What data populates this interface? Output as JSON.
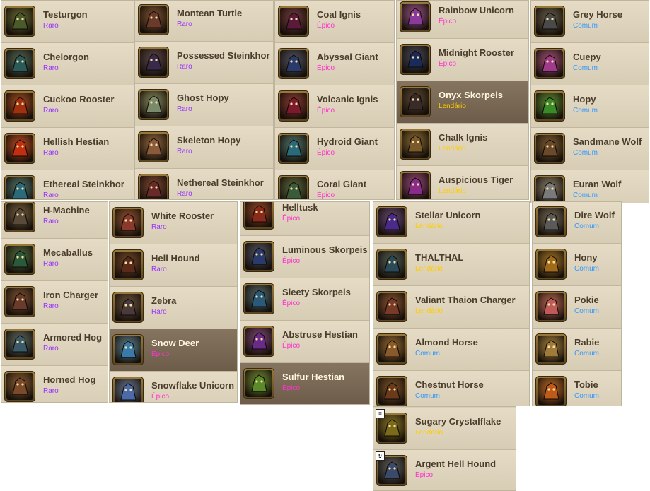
{
  "rarity_colors": {
    "Raro": "#9933ff",
    "Épico": "#ff33cc",
    "Lendário": "#ffcc00",
    "Comum": "#3399ff"
  },
  "panels": [
    {
      "items": [
        {
          "name": "Testurgon",
          "rarity": "Raro",
          "icon": "monster-portrait-icon",
          "color": "#4a5a2a"
        },
        {
          "name": "Chelorgon",
          "rarity": "Raro",
          "icon": "monster-portrait-icon",
          "color": "#2a5a5a"
        },
        {
          "name": "Cuckoo Rooster",
          "rarity": "Raro",
          "icon": "rooster-portrait-icon",
          "color": "#a03010"
        },
        {
          "name": "Hellish Hestian",
          "rarity": "Raro",
          "icon": "hestian-portrait-icon",
          "color": "#c03010"
        },
        {
          "name": "Ethereal Steinkhor",
          "rarity": "Raro",
          "icon": "steinkhor-portrait-icon",
          "color": "#2a6a7a"
        }
      ]
    },
    {
      "items": [
        {
          "name": "Montean Turtle",
          "rarity": "Raro",
          "icon": "turtle-portrait-icon",
          "color": "#6a3a2a"
        },
        {
          "name": "Possessed Steinkhor",
          "rarity": "Raro",
          "icon": "steinkhor-portrait-icon",
          "color": "#3a2a4a"
        },
        {
          "name": "Ghost Hopy",
          "rarity": "Raro",
          "icon": "hopy-portrait-icon",
          "color": "#7a8a6a"
        },
        {
          "name": "Skeleton Hopy",
          "rarity": "Raro",
          "icon": "hopy-portrait-icon",
          "color": "#8a5a3a"
        },
        {
          "name": "Nethereal Steinkhor",
          "rarity": "Raro",
          "icon": "steinkhor-portrait-icon",
          "color": "#6a2a2a"
        }
      ]
    },
    {
      "items": [
        {
          "name": "Coal Ignis",
          "rarity": "Épico",
          "icon": "ignis-portrait-icon",
          "color": "#5a1a3a"
        },
        {
          "name": "Abyssal Giant",
          "rarity": "Épico",
          "icon": "giant-portrait-icon",
          "color": "#2a3a6a"
        },
        {
          "name": "Volcanic Ignis",
          "rarity": "Épico",
          "icon": "ignis-portrait-icon",
          "color": "#7a1a2a"
        },
        {
          "name": "Hydroid Giant",
          "rarity": "Épico",
          "icon": "giant-portrait-icon",
          "color": "#2a6a7a"
        },
        {
          "name": "Coral Giant",
          "rarity": "Épico",
          "icon": "giant-portrait-icon",
          "color": "#3a5a3a"
        }
      ]
    },
    {
      "items": [
        {
          "name": "Rainbow Unicorn",
          "rarity": "Épico",
          "icon": "unicorn-portrait-icon",
          "color": "#8a3a9a"
        },
        {
          "name": "Midnight Rooster",
          "rarity": "Épico",
          "icon": "rooster-portrait-icon",
          "color": "#1a2a5a"
        },
        {
          "name": "Onyx Skorpeis",
          "rarity": "Lendário",
          "icon": "skorpeis-portrait-icon",
          "color": "#3a2a2a",
          "selected": true
        },
        {
          "name": "Chalk Ignis",
          "rarity": "Lendário",
          "icon": "ignis-portrait-icon",
          "color": "#7a5a2a"
        },
        {
          "name": "Auspicious Tiger",
          "rarity": "Lendário",
          "icon": "tiger-portrait-icon",
          "color": "#8a2a8a"
        }
      ]
    },
    {
      "items": [
        {
          "name": "Grey Horse",
          "rarity": "Comum",
          "icon": "horse-portrait-icon",
          "color": "#4a4a4a"
        },
        {
          "name": "Cuepy",
          "rarity": "Comum",
          "icon": "cuepy-portrait-icon",
          "color": "#a03a8a"
        },
        {
          "name": "Hopy",
          "rarity": "Comum",
          "icon": "hopy-portrait-icon",
          "color": "#3a8a2a"
        },
        {
          "name": "Sandmane Wolf",
          "rarity": "Comum",
          "icon": "wolf-portrait-icon",
          "color": "#6a4a2a"
        },
        {
          "name": "Euran Wolf",
          "rarity": "Comum",
          "icon": "wolf-portrait-icon",
          "color": "#7a7a7a"
        }
      ]
    },
    {
      "items": [
        {
          "name": "H-Machine",
          "rarity": "Raro",
          "icon": "machine-portrait-icon",
          "color": "#5a4a3a"
        },
        {
          "name": "Mecaballus",
          "rarity": "Raro",
          "icon": "mecaballus-portrait-icon",
          "color": "#2a5a3a"
        },
        {
          "name": "Iron Charger",
          "rarity": "Raro",
          "icon": "charger-portrait-icon",
          "color": "#6a3a2a"
        },
        {
          "name": "Armored Hog",
          "rarity": "Raro",
          "icon": "hog-portrait-icon",
          "color": "#3a5a6a"
        },
        {
          "name": "Horned Hog",
          "rarity": "Raro",
          "icon": "hog-portrait-icon",
          "color": "#7a4a2a"
        }
      ]
    },
    {
      "items": [
        {
          "name": "White Rooster",
          "rarity": "Raro",
          "icon": "rooster-portrait-icon",
          "color": "#8a3a2a"
        },
        {
          "name": "Hell Hound",
          "rarity": "Raro",
          "icon": "hound-portrait-icon",
          "color": "#5a2a1a"
        },
        {
          "name": "Zebra",
          "rarity": "Raro",
          "icon": "zebra-portrait-icon",
          "color": "#4a3a3a"
        },
        {
          "name": "Snow Deer",
          "rarity": "Épico",
          "icon": "deer-portrait-icon",
          "color": "#3a7aaa",
          "selected": true
        },
        {
          "name": "Snowflake Unicorn",
          "rarity": "Épico",
          "icon": "unicorn-portrait-icon",
          "color": "#4a6aaa"
        }
      ]
    },
    {
      "items": [
        {
          "name": "Helltusk",
          "rarity": "Épico",
          "icon": "helltusk-portrait-icon",
          "color": "#8a2a1a"
        },
        {
          "name": "Luminous Skorpeis",
          "rarity": "Épico",
          "icon": "skorpeis-portrait-icon",
          "color": "#2a3a6a"
        },
        {
          "name": "Sleety Skorpeis",
          "rarity": "Épico",
          "icon": "skorpeis-portrait-icon",
          "color": "#2a5a7a"
        },
        {
          "name": "Abstruse Hestian",
          "rarity": "Épico",
          "icon": "hestian-portrait-icon",
          "color": "#6a2a8a"
        },
        {
          "name": "Sulfur Hestian",
          "rarity": "Épico",
          "icon": "hestian-portrait-icon",
          "color": "#5a8a2a",
          "selected": true
        }
      ]
    },
    {
      "items": [
        {
          "name": "Stellar Unicorn",
          "rarity": "Lendário",
          "icon": "unicorn-portrait-icon",
          "color": "#4a2a8a"
        },
        {
          "name": "THALTHAL",
          "rarity": "Lendário",
          "icon": "thalthal-portrait-icon",
          "color": "#2a4a5a"
        },
        {
          "name": "Valiant Thaion Charger",
          "rarity": "Lendário",
          "icon": "charger-portrait-icon",
          "color": "#7a3a2a"
        },
        {
          "name": "Almond Horse",
          "rarity": "Comum",
          "icon": "horse-portrait-icon",
          "color": "#8a5a2a"
        },
        {
          "name": "Chestnut Horse",
          "rarity": "Comum",
          "icon": "horse-portrait-icon",
          "color": "#6a3a1a"
        }
      ]
    },
    {
      "items": [
        {
          "name": "Dire Wolf",
          "rarity": "Comum",
          "icon": "wolf-portrait-icon",
          "color": "#5a5a5a"
        },
        {
          "name": "Hony",
          "rarity": "Comum",
          "icon": "hony-portrait-icon",
          "color": "#a06a1a"
        },
        {
          "name": "Pokie",
          "rarity": "Comum",
          "icon": "pokie-portrait-icon",
          "color": "#c05a5a"
        },
        {
          "name": "Rabie",
          "rarity": "Comum",
          "icon": "rabie-portrait-icon",
          "color": "#a07a3a"
        },
        {
          "name": "Tobie",
          "rarity": "Comum",
          "icon": "tobie-portrait-icon",
          "color": "#c05a1a"
        }
      ]
    },
    {
      "items": [
        {
          "name": "Sugary Crystalflake",
          "rarity": "Lendário",
          "icon": "crystalflake-portrait-icon",
          "color": "#7a6a1a",
          "badge": "="
        },
        {
          "name": "Argent Hell Hound",
          "rarity": "Épico",
          "icon": "hound-portrait-icon",
          "color": "#3a4a6a",
          "badge": "9"
        }
      ]
    }
  ]
}
